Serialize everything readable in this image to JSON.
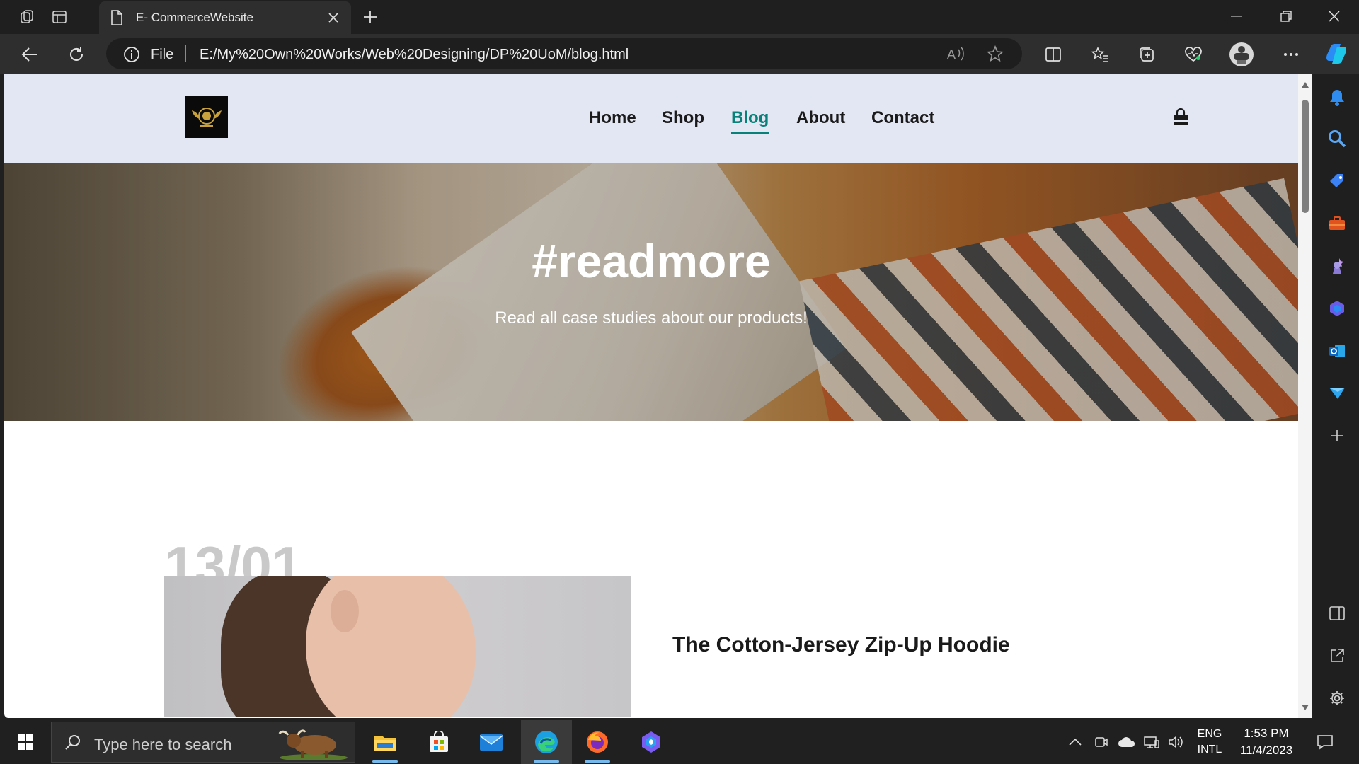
{
  "browser": {
    "tab_title": "E- CommerceWebsite",
    "address_scheme": "File",
    "url": "E:/My%20Own%20Works/Web%20Designing/DP%20UoM/blog.html"
  },
  "site": {
    "nav": [
      {
        "label": "Home",
        "active": false
      },
      {
        "label": "Shop",
        "active": false
      },
      {
        "label": "Blog",
        "active": true
      },
      {
        "label": "About",
        "active": false
      },
      {
        "label": "Contact",
        "active": false
      }
    ],
    "hero": {
      "title": "#readmore",
      "subtitle": "Read all case studies about our products!"
    },
    "post": {
      "date": "13/01",
      "title": "The Cotton-Jersey Zip-Up Hoodie"
    },
    "accent_color": "#088178",
    "header_bg": "#e3e6f3"
  },
  "taskbar": {
    "search_placeholder": "Type here to search",
    "language_top": "ENG",
    "language_bottom": "INTL",
    "time": "1:53 PM",
    "date": "11/4/2023"
  }
}
